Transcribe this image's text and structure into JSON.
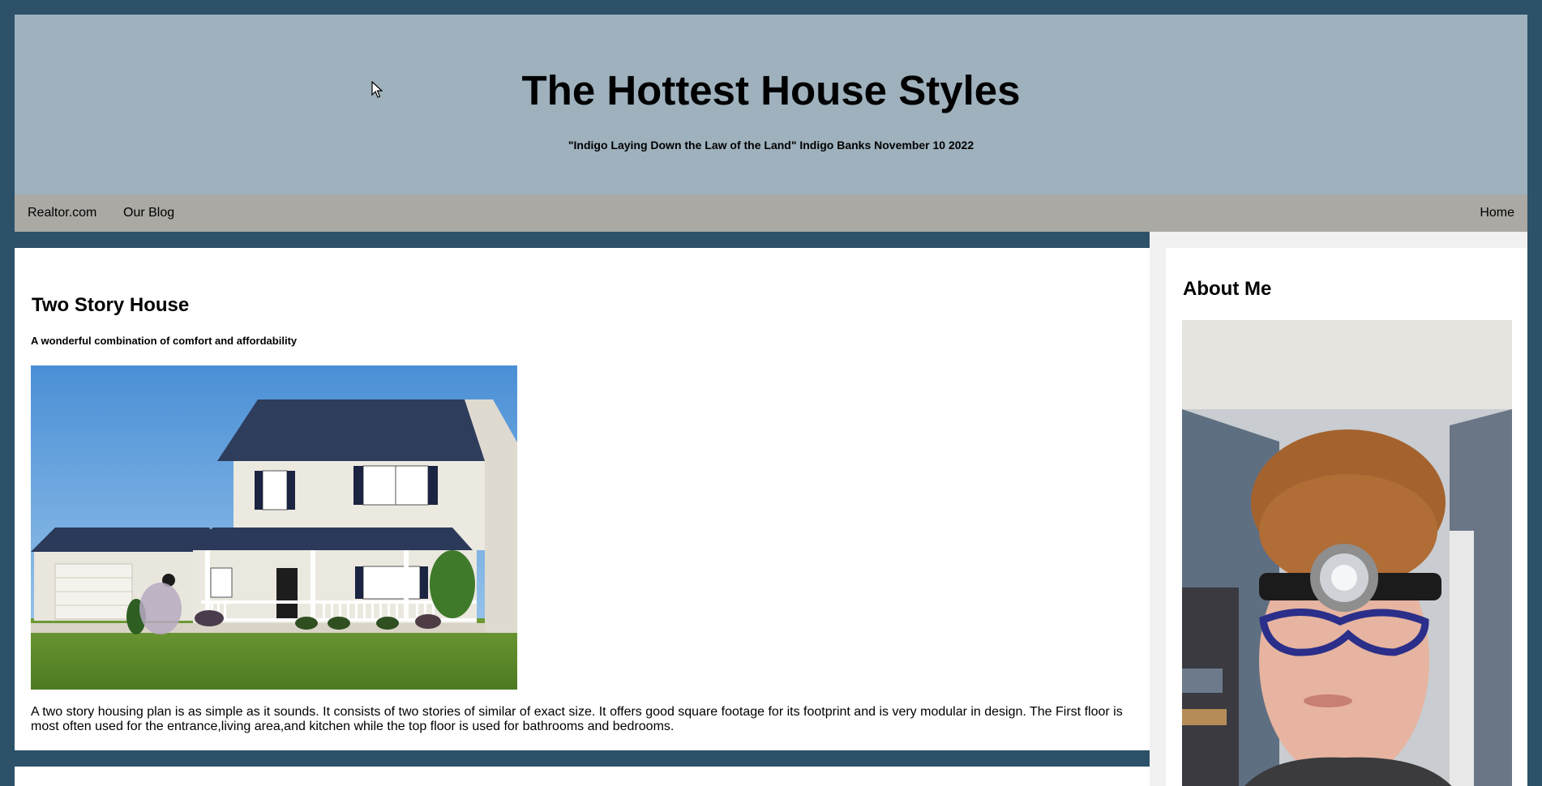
{
  "header": {
    "title": "The Hottest House Styles",
    "subtitle": "\"Indigo Laying Down the Law of the Land\" Indigo Banks November 10 2022"
  },
  "nav": {
    "left_links": [
      "Realtor.com",
      "Our Blog"
    ],
    "right_link": "Home"
  },
  "post": {
    "title": "Two Story House",
    "subtitle": "A wonderful combination of comfort and affordability",
    "body": "A two story housing plan is as simple as it sounds. It consists of two stories of similar of exact size. It offers good square footage for its footprint and is very modular in design. The First floor is most often used for the entrance,living area,and kitchen while the top floor is used for bathrooms and bedrooms."
  },
  "sidebar": {
    "title": "About Me"
  },
  "colors": {
    "page_background": "#2c5169",
    "header_background": "#9eb1bd",
    "nav_background": "#aaa9a4",
    "card_background": "#ffffff",
    "sidebar_background": "#f1f1f1"
  },
  "icons": {
    "cursor": "mouse-pointer-icon"
  }
}
